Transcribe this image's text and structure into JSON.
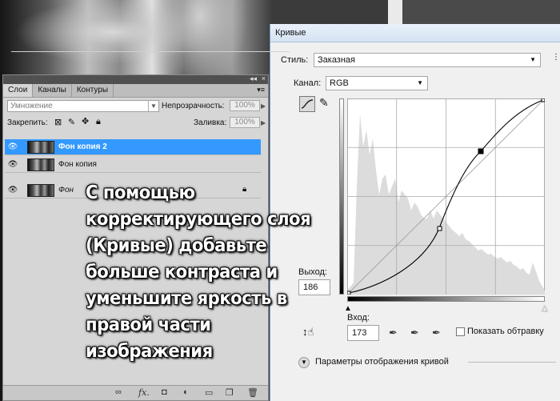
{
  "layers_panel": {
    "tabs": [
      "Слои",
      "Каналы",
      "Контуры"
    ],
    "blend_mode": "Умножение",
    "opacity_label": "Непрозрачность:",
    "opacity_value": "100%",
    "lock_label": "Закрепить:",
    "fill_label": "Заливка:",
    "fill_value": "100%",
    "layers": [
      {
        "name": "Фон копия 2",
        "selected": true
      },
      {
        "name": "Фон копия",
        "selected": false
      },
      {
        "name": "Фон",
        "selected": false,
        "locked": true
      }
    ]
  },
  "overlay_text": [
    "С помощью",
    "корректирующего слоя",
    "(Кривые) добавьте",
    "больше контраста и",
    "уменьшите яркость в",
    "правой части",
    "изображения"
  ],
  "curves_dialog": {
    "title": "Кривые",
    "style_label": "Стиль:",
    "style_value": "Заказная",
    "channel_label": "Канал:",
    "channel_value": "RGB",
    "output_label": "Выход:",
    "output_value": "186",
    "input_label": "Вход:",
    "input_value": "173",
    "clipping_label": "Показать обтравку",
    "options_label": "Параметры отображения кривой"
  }
}
